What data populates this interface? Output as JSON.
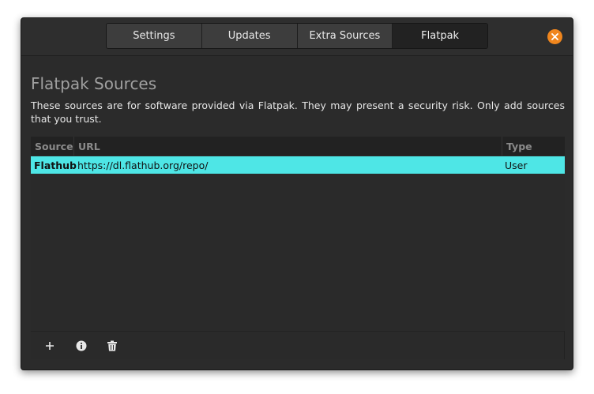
{
  "window": {
    "tabs": [
      {
        "label": "Settings"
      },
      {
        "label": "Updates"
      },
      {
        "label": "Extra Sources"
      },
      {
        "label": "Flatpak"
      }
    ],
    "active_tab": "Flatpak",
    "close_icon": "close-icon"
  },
  "page": {
    "title": "Flatpak Sources",
    "description": "These sources are for software provided via Flatpak. They may present a security risk. Only add sources that you trust."
  },
  "table": {
    "columns": {
      "source": "Source",
      "url": "URL",
      "type": "Type"
    },
    "rows": [
      {
        "source": "Flathub",
        "url": "https://dl.flathub.org/repo/",
        "type": "User",
        "selected": true
      }
    ]
  },
  "toolbar": {
    "icons": [
      "add-icon",
      "info-icon",
      "trash-icon"
    ]
  },
  "colors": {
    "accent_close": "#f0861d",
    "selection": "#4ee6e6",
    "window_bg": "#2b2b2b"
  }
}
